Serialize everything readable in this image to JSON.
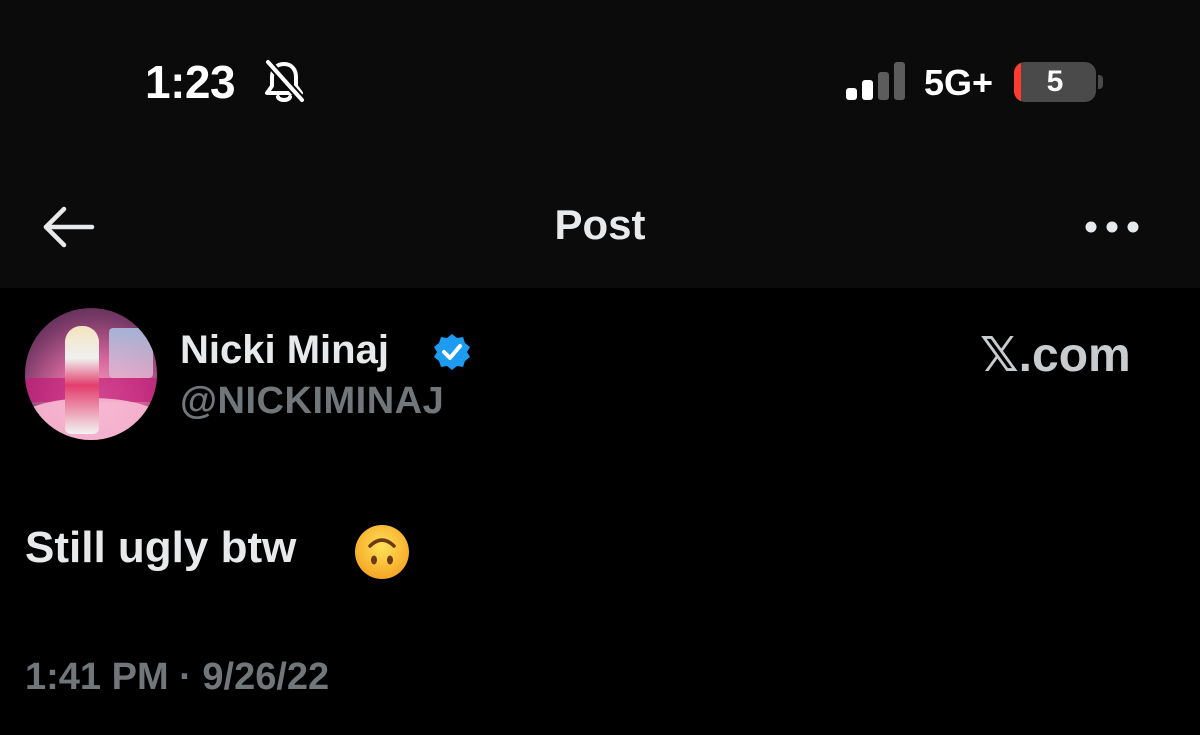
{
  "status_bar": {
    "time": "1:23",
    "mute_icon": "bell-slash-icon",
    "signal_icon": "cellular-signal-icon",
    "signal_bars_active": 2,
    "signal_bars_total": 4,
    "network": "5G+",
    "battery_level": "5",
    "battery_fraction": 0.05,
    "battery_color": "#ff3b30"
  },
  "header": {
    "back_icon": "arrow-left-icon",
    "title": "Post",
    "more_icon": "ellipsis-icon"
  },
  "post": {
    "author": {
      "display_name": "Nicki Minaj",
      "verified_icon": "verified-badge-icon",
      "verified_color": "#1d9bf0",
      "handle": "@NICKIMINAJ"
    },
    "watermark": "𝕏.com",
    "text": "Still ugly btw",
    "emoji": "upside-down-face-emoji",
    "timestamp": "1:41 PM · 9/26/22"
  },
  "colors": {
    "background": "#000000",
    "text_primary": "#e7e9ea",
    "text_secondary": "#71767b"
  }
}
